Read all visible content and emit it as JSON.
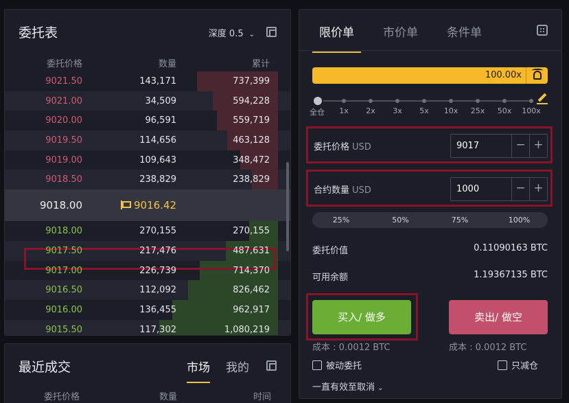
{
  "order_book": {
    "title": "委托表",
    "depth_label": "深度 0.5",
    "columns": [
      "委托价格",
      "数量",
      "累计"
    ],
    "asks": [
      {
        "price": "9021.50",
        "qty": "143,171",
        "total": "737,399",
        "depth": 0.62
      },
      {
        "price": "9021.00",
        "qty": "34,509",
        "total": "594,228",
        "depth": 0.5
      },
      {
        "price": "9020.00",
        "qty": "96,591",
        "total": "559,719",
        "depth": 0.47
      },
      {
        "price": "9019.50",
        "qty": "114,656",
        "total": "463,128",
        "depth": 0.39
      },
      {
        "price": "9019.00",
        "qty": "109,643",
        "total": "348,472",
        "depth": 0.29
      },
      {
        "price": "9018.50",
        "qty": "238,829",
        "total": "238,829",
        "depth": 0.2
      }
    ],
    "mid_price": "9018.00",
    "mark_price": "9016.42",
    "bids": [
      {
        "price": "9018.00",
        "qty": "270,155",
        "total": "270,155",
        "depth": 0.22
      },
      {
        "price": "9017.50",
        "qty": "217,476",
        "total": "487,631",
        "depth": 0.4
      },
      {
        "price": "9017.00",
        "qty": "226,739",
        "total": "714,370",
        "depth": 0.6
      },
      {
        "price": "9016.50",
        "qty": "112,092",
        "total": "826,462",
        "depth": 0.69
      },
      {
        "price": "9016.00",
        "qty": "136,455",
        "total": "962,917",
        "depth": 0.81
      },
      {
        "price": "9015.50",
        "qty": "117,302",
        "total": "1,080,219",
        "depth": 0.91
      }
    ]
  },
  "recent_trades": {
    "title": "最近成交",
    "tab_market": "市场",
    "tab_mine": "我的",
    "columns": [
      "委托价格",
      "数量",
      "时间"
    ]
  },
  "trade_form": {
    "tabs": [
      "限价单",
      "市价单",
      "条件单"
    ],
    "leverage": "100.00x",
    "slider_labels": [
      "全仓",
      "1x",
      "2x",
      "3x",
      "5x",
      "10x",
      "25x",
      "50x",
      "100x"
    ],
    "price_label": "委托价格",
    "price_unit": "USD",
    "price_value": "9017",
    "qty_label": "合约数量",
    "qty_unit": "USD",
    "qty_value": "1000",
    "pct_buttons": [
      "25%",
      "50%",
      "75%",
      "100%"
    ],
    "order_value_label": "委托价值",
    "order_value": "0.11090163 BTC",
    "balance_label": "可用余额",
    "balance": "1.19367135 BTC",
    "buy_label": "买入/ 做多",
    "sell_label": "卖出/ 做空",
    "buy_cost": "成本 : 0.0012 BTC",
    "sell_cost": "成本 : 0.0012 BTC",
    "passive_label": "被动委托",
    "reduce_only_label": "只减仓",
    "tif_label": "一直有效至取消"
  },
  "colors": {
    "ask": "#d25a72",
    "bid": "#8bc34a",
    "accent": "#f7b928",
    "buy": "#6aae35",
    "sell": "#c2506a",
    "highlight": "#8a1329"
  }
}
